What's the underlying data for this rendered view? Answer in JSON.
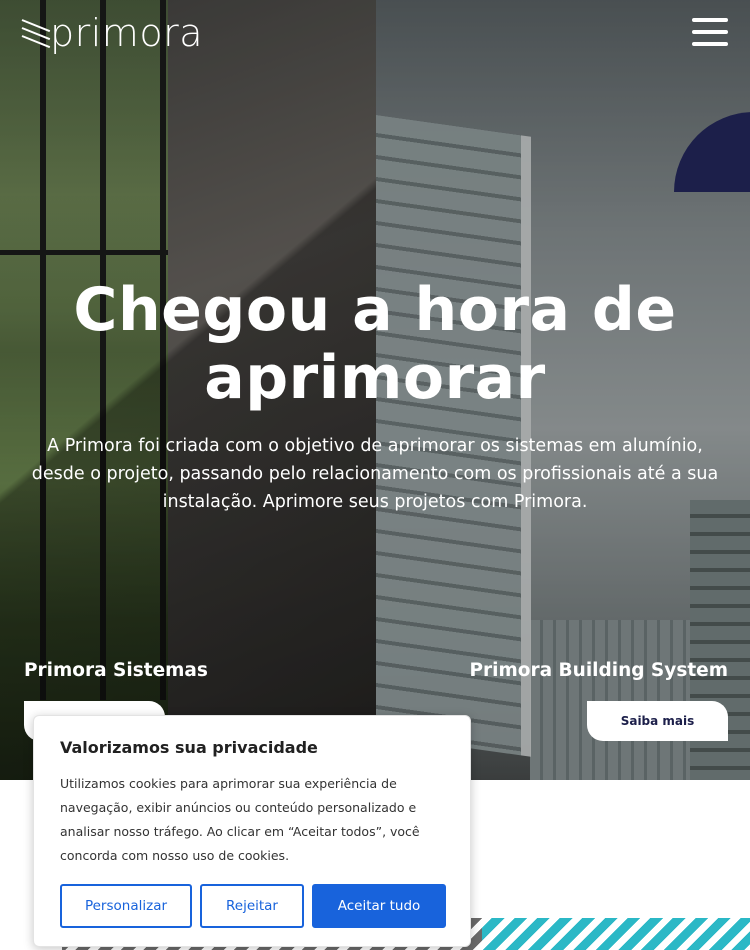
{
  "header": {
    "logo_text": "primora",
    "menu_icon": "hamburger-menu-icon"
  },
  "hero": {
    "headline": "Chegou a hora de aprimorar",
    "subtext": "A Primora foi criada com o objetivo de aprimorar os sistemas em alumínio, desde  o projeto, passando pelo relacionamento com os profissionais até a sua instalação.  Aprimore seus projetos com Primora."
  },
  "brands": {
    "left_label": "Primora Sistemas",
    "right_label": "Primora Building System",
    "right_button": "Saiba mais"
  },
  "cookie_banner": {
    "title": "Valorizamos sua privacidade",
    "body": "Utilizamos cookies para aprimorar sua experiência de navegação, exibir anúncios ou conteúdo personalizado e analisar nosso tráfego. Ao clicar em “Aceitar todos”, você concorda com nosso uso de cookies.",
    "customize_label": "Personalizar",
    "reject_label": "Rejeitar",
    "accept_label": "Aceitar tudo"
  },
  "colors": {
    "brand_navy": "#1c1f4a",
    "cookie_blue": "#1863dc",
    "stripe_teal": "#2bb8c6"
  }
}
